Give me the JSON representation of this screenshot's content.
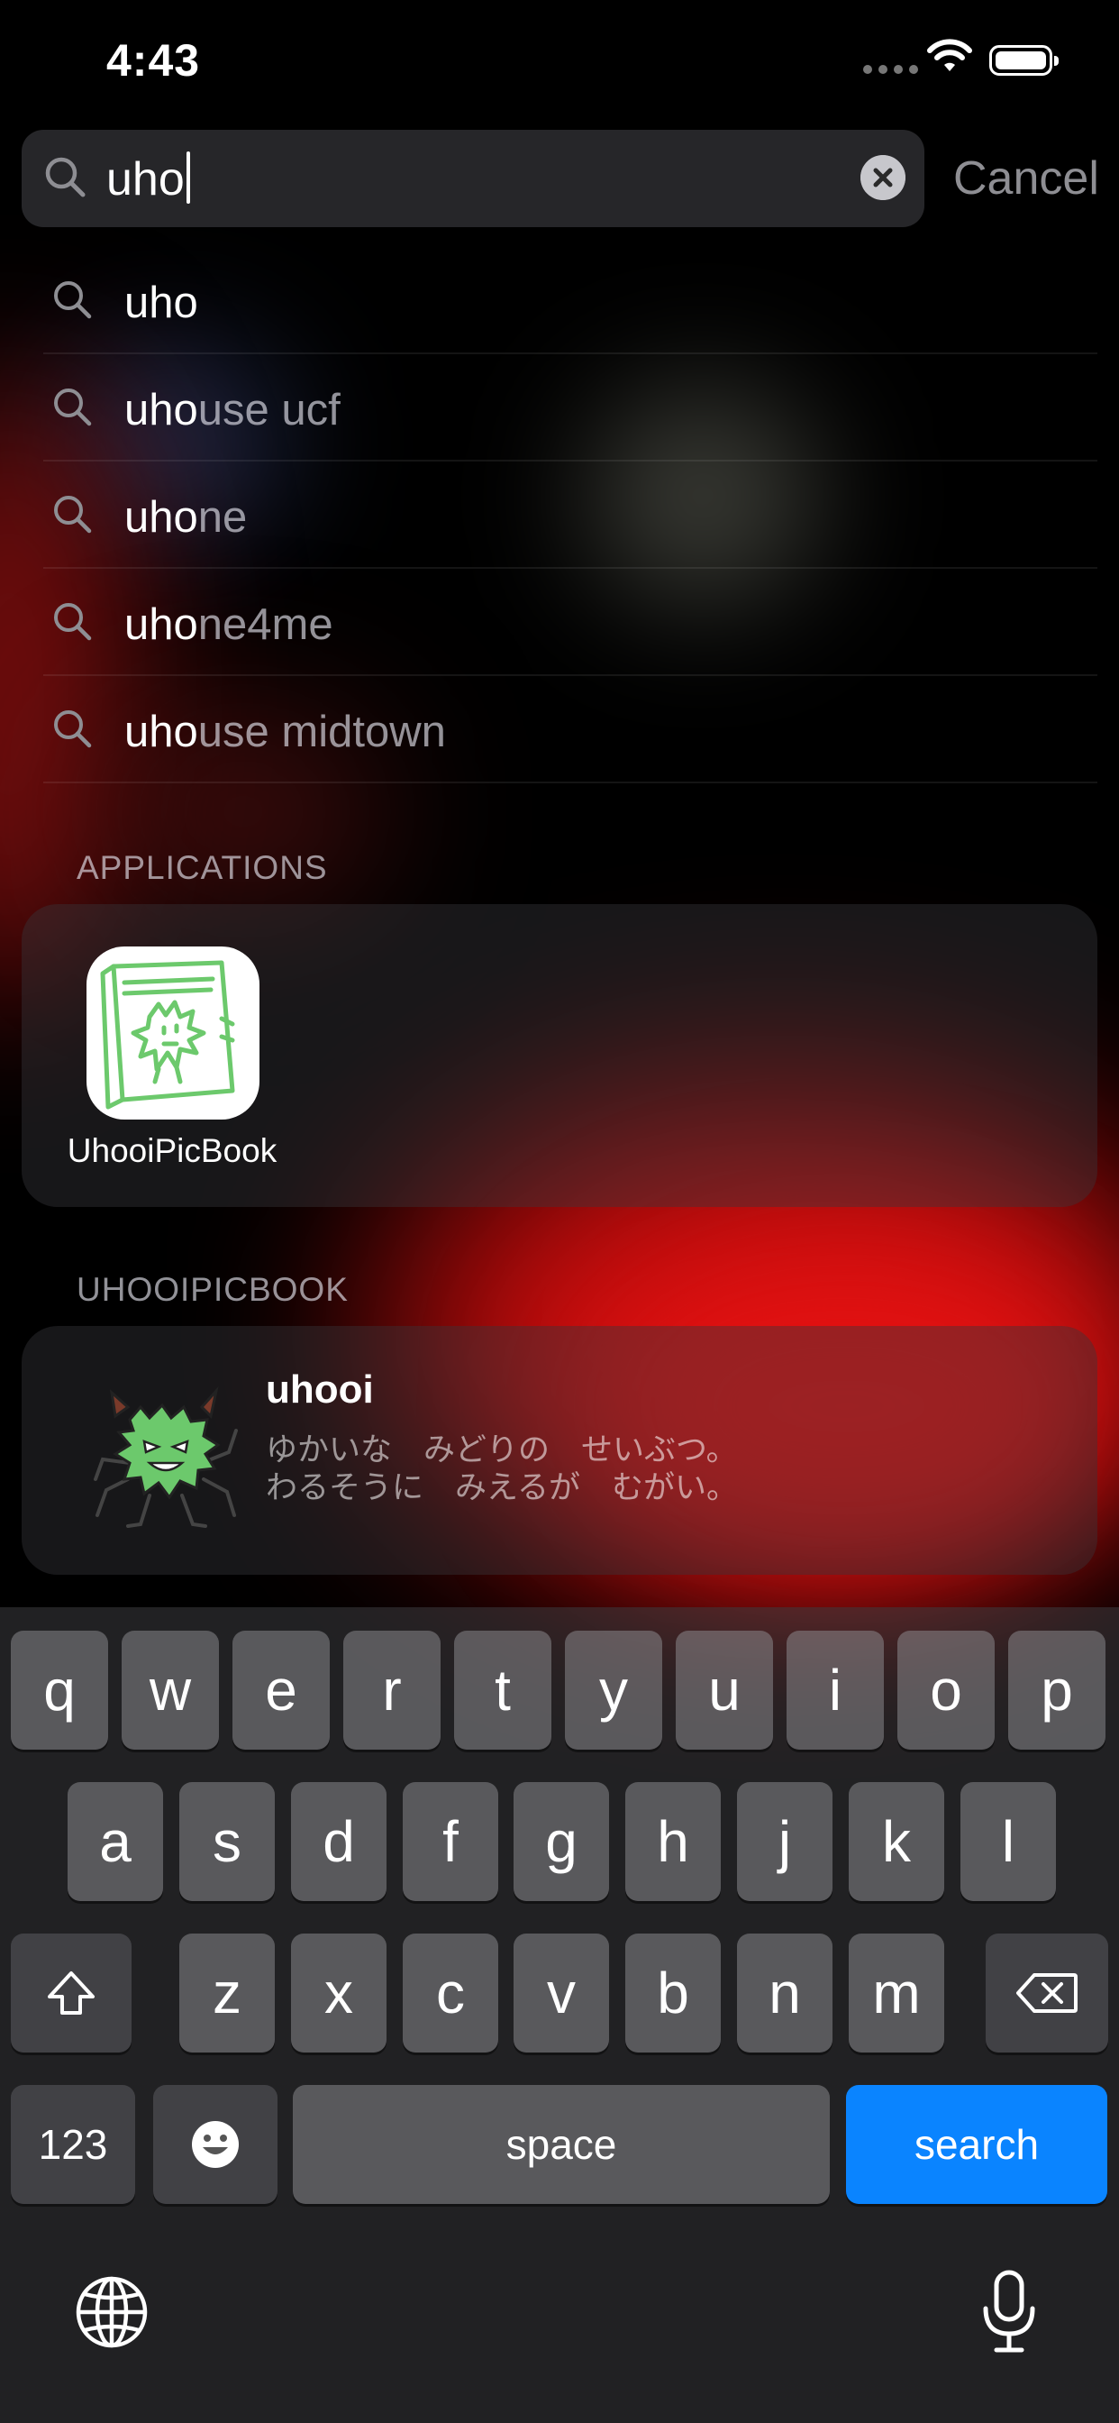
{
  "status_bar": {
    "time": "4:43"
  },
  "search": {
    "query": "uho",
    "cancel_label": "Cancel"
  },
  "suggestions": [
    {
      "match": "uho",
      "rest": ""
    },
    {
      "match": "uho",
      "rest": "use ucf"
    },
    {
      "match": "uho",
      "rest": "ne"
    },
    {
      "match": "uho",
      "rest": "ne4me"
    },
    {
      "match": "uho",
      "rest": "use midtown"
    }
  ],
  "applications": {
    "header": "APPLICATIONS",
    "items": [
      {
        "name": "UhooiPicBook",
        "icon": "uhooi-book-icon"
      }
    ]
  },
  "app_results": {
    "header": "UHOOIPICBOOK",
    "items": [
      {
        "title": "uhooi",
        "subtitle_line1": "ゆかいな　みどりの　せいぶつ。",
        "subtitle_line2": "わるそうに　みえるが　むがい。",
        "icon": "uhooi-monster-icon"
      }
    ]
  },
  "keyboard": {
    "row1": [
      "q",
      "w",
      "e",
      "r",
      "t",
      "y",
      "u",
      "i",
      "o",
      "p"
    ],
    "row2": [
      "a",
      "s",
      "d",
      "f",
      "g",
      "h",
      "j",
      "k",
      "l"
    ],
    "row3": [
      "z",
      "x",
      "c",
      "v",
      "b",
      "n",
      "m"
    ],
    "numbers_label": "123",
    "space_label": "space",
    "search_label": "search"
  },
  "colors": {
    "accent": "#0a84ff",
    "background_red": "#d50b0b",
    "app_icon_green": "#6cc96c"
  }
}
